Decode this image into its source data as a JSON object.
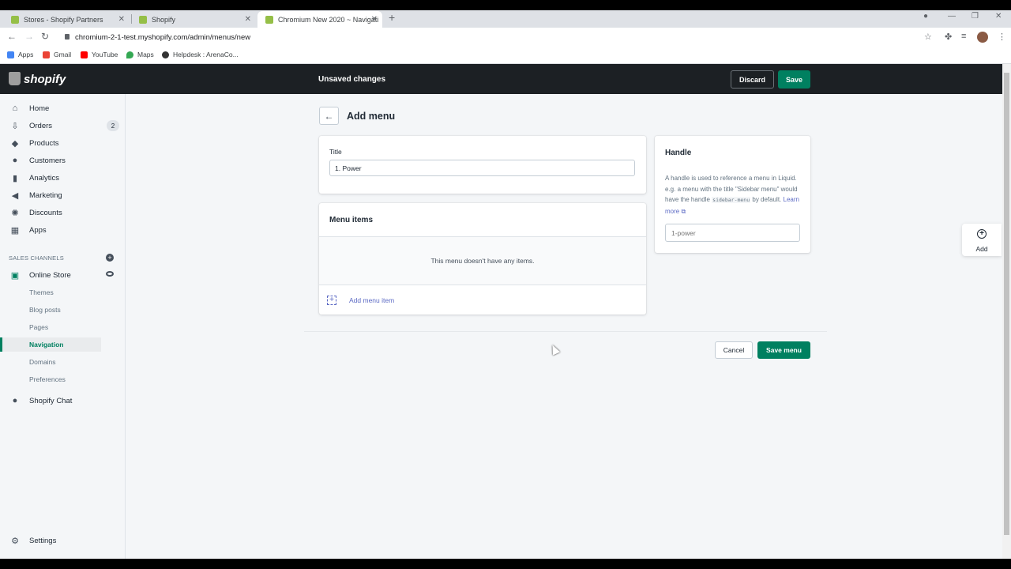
{
  "browser": {
    "tabs": [
      {
        "label": "Stores - Shopify Partners"
      },
      {
        "label": "Shopify"
      },
      {
        "label": "Chromium New 2020 ~ Navigati"
      }
    ],
    "url": "chromium-2-1-test.myshopify.com/admin/menus/new",
    "bookmarks": [
      {
        "label": "Apps"
      },
      {
        "label": "Gmail"
      },
      {
        "label": "YouTube"
      },
      {
        "label": "Maps"
      },
      {
        "label": "Helpdesk : ArenaCo..."
      }
    ]
  },
  "topbar": {
    "logo": "shopify",
    "status": "Unsaved changes",
    "discard_label": "Discard",
    "save_label": "Save"
  },
  "sidebar": {
    "items": [
      {
        "label": "Home",
        "icon": "home-icon"
      },
      {
        "label": "Orders",
        "icon": "orders-icon",
        "badge": "2"
      },
      {
        "label": "Products",
        "icon": "tag-icon"
      },
      {
        "label": "Customers",
        "icon": "person-icon"
      },
      {
        "label": "Analytics",
        "icon": "bar-chart-icon"
      },
      {
        "label": "Marketing",
        "icon": "megaphone-icon"
      },
      {
        "label": "Discounts",
        "icon": "discount-icon"
      },
      {
        "label": "Apps",
        "icon": "apps-icon"
      }
    ],
    "sales_channels_label": "SALES CHANNELS",
    "online_store_label": "Online Store",
    "sub_items": [
      {
        "label": "Themes"
      },
      {
        "label": "Blog posts"
      },
      {
        "label": "Pages"
      },
      {
        "label": "Navigation",
        "active": true
      },
      {
        "label": "Domains"
      },
      {
        "label": "Preferences"
      }
    ],
    "shopify_chat_label": "Shopify Chat",
    "settings_label": "Settings"
  },
  "main": {
    "page_title": "Add menu",
    "title_card": {
      "label": "Title",
      "value": "1. Power"
    },
    "menu_items": {
      "heading": "Menu items",
      "empty_text": "This menu doesn't have any items.",
      "add_label": "Add menu item"
    },
    "handle": {
      "heading": "Handle",
      "desc_1": "A handle is used to reference a menu in Liquid. e.g. a menu with the title \"Sidebar menu\" would have the handle ",
      "desc_code": "sidebar-menu",
      "desc_2": " by default. ",
      "learn_more": "Learn more",
      "placeholder": "1-power"
    },
    "cancel_label": "Cancel",
    "save_menu_label": "Save menu"
  },
  "side_panel": {
    "add_label": "Add"
  },
  "colors": {
    "primary_green": "#008060",
    "topbar_bg": "#1c2024",
    "link": "#5c6ac4"
  }
}
